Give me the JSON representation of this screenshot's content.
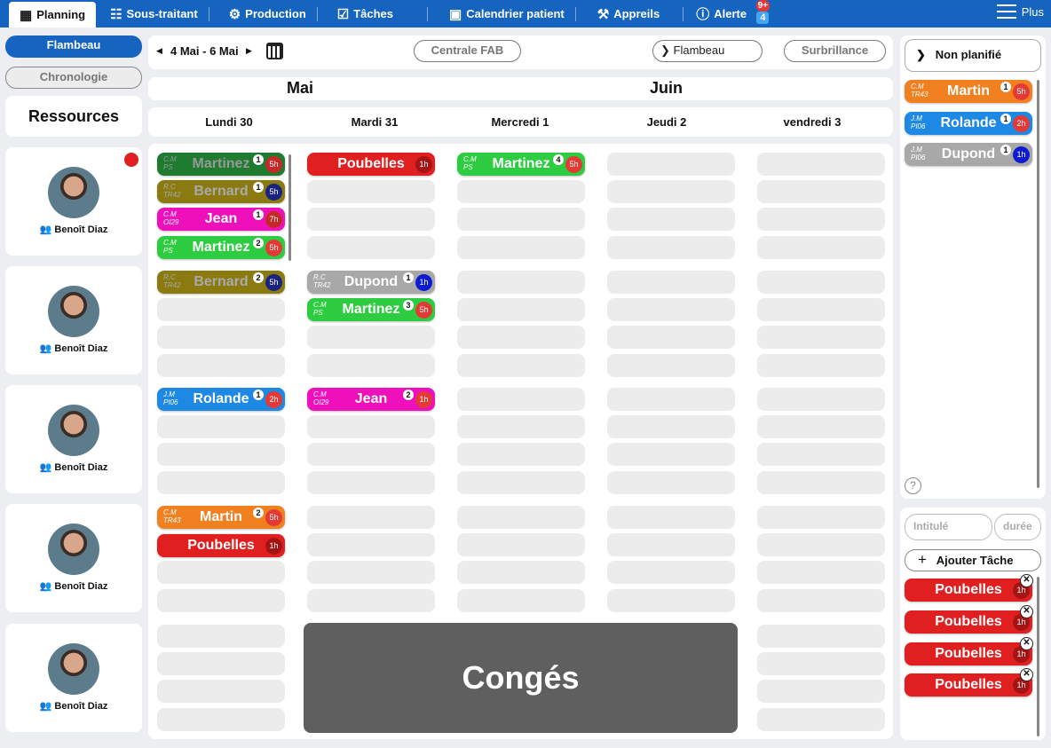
{
  "nav": {
    "tabs": [
      {
        "label": "Planning",
        "icon": "planning-icon"
      },
      {
        "label": "Sous-traitant",
        "icon": "subcontractor-icon"
      },
      {
        "label": "Production",
        "icon": "production-icon"
      },
      {
        "label": "Tâches",
        "icon": "tasks-icon"
      },
      {
        "label": "Calendrier patient",
        "icon": "calendar-icon"
      },
      {
        "label": "Appreils",
        "icon": "devices-icon"
      },
      {
        "label": "Alerte",
        "icon": "alert-icon"
      }
    ],
    "alert_badge_top": "9+",
    "alert_badge_bottom": "4",
    "more_label": "Plus"
  },
  "left": {
    "view_flambeau": "Flambeau",
    "view_chronologie": "Chronologie",
    "resources_title": "Ressources",
    "resources": [
      {
        "name": "Benoît Diaz"
      },
      {
        "name": "Benoît Diaz"
      },
      {
        "name": "Benoît Diaz"
      },
      {
        "name": "Benoît Diaz"
      },
      {
        "name": "Benoît Diaz"
      }
    ]
  },
  "toolbar": {
    "date_range": "4 Mai - 6 Mai",
    "centrale_label": "Centrale FAB",
    "flambeau_label": "Flambeau",
    "surbrillance_label": "Surbrillance"
  },
  "calendar": {
    "months": [
      "Mai",
      "Juin"
    ],
    "days": [
      "Lundi 30",
      "Mardi 31",
      "Mercredi 1",
      "Jeudi 2",
      "vendredi 3"
    ]
  },
  "tasks": [
    {
      "c1": "C.M",
      "c2": "PS",
      "name": "Martinez",
      "num": "1",
      "dur": "5h"
    },
    {
      "c1": "R.C",
      "c2": "TR42",
      "name": "Bernard",
      "num": "1",
      "dur": "5h"
    },
    {
      "c1": "C.M",
      "c2": "OI29",
      "name": "Jean",
      "num": "1",
      "dur": "7h"
    },
    {
      "c1": "C.M",
      "c2": "PS",
      "name": "Martinez",
      "num": "2",
      "dur": "5h"
    },
    {
      "c1": "R.C",
      "c2": "TR42",
      "name": "Bernard",
      "num": "2",
      "dur": "5h"
    },
    {
      "c1": "J.M",
      "c2": "PI06",
      "name": "Rolande",
      "num": "1",
      "dur": "2h"
    },
    {
      "c1": "C.M",
      "c2": "TR43",
      "name": "Martin",
      "num": "2",
      "dur": "5h"
    },
    {
      "c1": "",
      "c2": "",
      "name": "Poubelles",
      "num": "",
      "dur": "1h"
    },
    {
      "c1": "",
      "c2": "",
      "name": "Poubelles",
      "num": "",
      "dur": "1h"
    },
    {
      "c1": "R.C",
      "c2": "TR42",
      "name": "Dupond",
      "num": "1",
      "dur": "1h"
    },
    {
      "c1": "C.M",
      "c2": "PS",
      "name": "Martinez",
      "num": "3",
      "dur": "5h"
    },
    {
      "c1": "C.M",
      "c2": "OI29",
      "name": "Jean",
      "num": "2",
      "dur": "1h"
    },
    {
      "c1": "C.M",
      "c2": "PS",
      "name": "Martinez",
      "num": "4",
      "dur": "5h"
    }
  ],
  "conges_label": "Congés",
  "right": {
    "unplanned_label": "Non planifié",
    "unplanned": [
      {
        "c1": "C.M",
        "c2": "TR43",
        "name": "Martin",
        "num": "1",
        "dur": "5h"
      },
      {
        "c1": "J.M",
        "c2": "PI06",
        "name": "Rolande",
        "num": "1",
        "dur": "2h"
      },
      {
        "c1": "J.M",
        "c2": "PI06",
        "name": "Dupond",
        "num": "1",
        "dur": "1h"
      }
    ],
    "help": "?",
    "title_placeholder": "Intitulé",
    "duration_placeholder": "durée",
    "add_task_label": "Ajouter Tâche",
    "custom_tasks": [
      {
        "name": "Poubelles",
        "dur": "1h"
      },
      {
        "name": "Poubelles",
        "dur": "1h"
      },
      {
        "name": "Poubelles",
        "dur": "1h"
      },
      {
        "name": "Poubelles",
        "dur": "1h"
      }
    ]
  },
  "colors": {
    "nav": "#1565c0",
    "green": "#2ecc40",
    "darkgreen": "#1e7b30",
    "olive": "#8a7a10",
    "magenta": "#ee11bb",
    "blue": "#1e88e5",
    "orange": "#f08020",
    "red": "#e02020",
    "gray": "#a8a8a8"
  }
}
